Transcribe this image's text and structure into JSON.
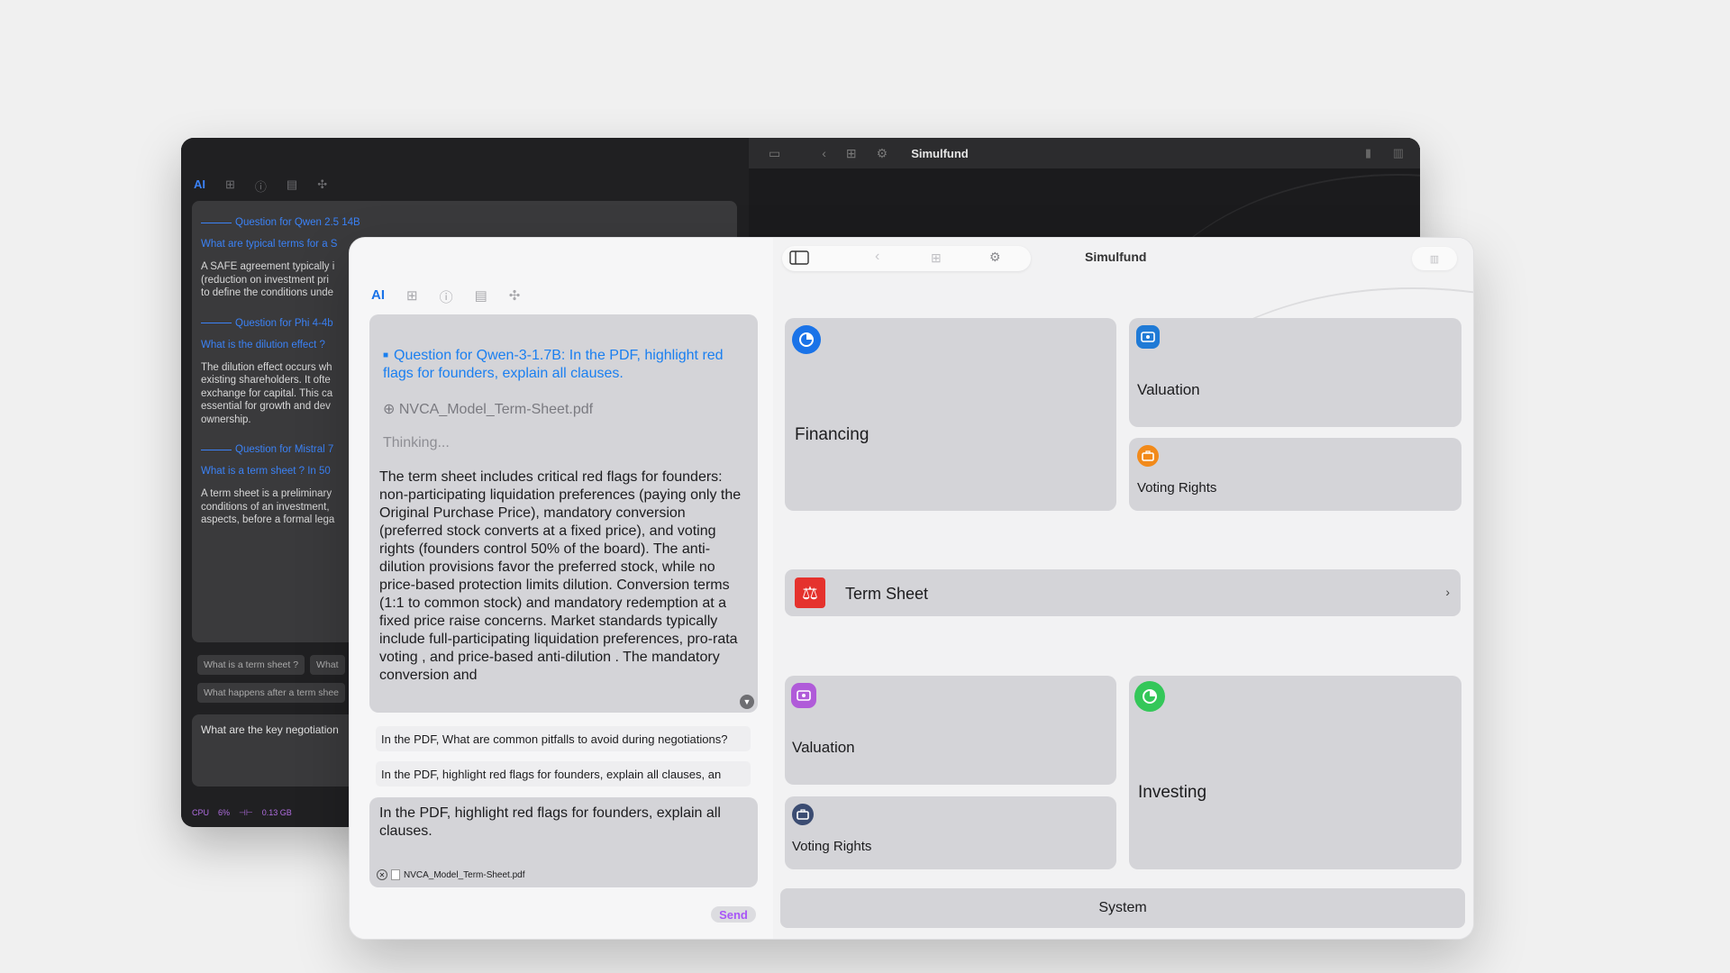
{
  "dark_window": {
    "title": "Simulfund",
    "tabs": [
      "AI",
      "⊞",
      "ⓘ",
      "▤",
      "✣"
    ],
    "chat": [
      {
        "header": "Question for Qwen 2.5 14B",
        "question": "What are typical terms for a S",
        "answer": "A SAFE agreement typically i\n(reduction on investment pri\nto define the conditions unde"
      },
      {
        "header": "Question for Phi 4-4b",
        "question": "What is the dilution effect ?",
        "answer": "The dilution effect occurs wh\nexisting shareholders. It ofte\nexchange for capital. This ca\nessential for growth and dev\nownership."
      },
      {
        "header": "Question for Mistral 7",
        "question": "What is a term sheet ? In 50",
        "answer": "A term sheet is a preliminary\nconditions of an investment,\naspects, before a formal lega"
      }
    ],
    "chips_row1": [
      "What is a term sheet ?",
      "What"
    ],
    "chips_row2": [
      "What happens after a term shee"
    ],
    "input_text": "What are the key negotiation",
    "status": {
      "cpu_label": "CPU",
      "cpu_value": "6%",
      "mem_icon": "⊣⊢",
      "mem_value": "0.13 GB"
    }
  },
  "window": {
    "title": "Simulfund",
    "toolbar_icons": [
      "sidebar-icon",
      "back-icon",
      "grid-icon",
      "gear-icon"
    ],
    "sidebar_toggle_icon": "▥"
  },
  "left_panel": {
    "tabs": [
      {
        "label": "AI",
        "icon": "ai"
      },
      {
        "label": "⊞",
        "icon": "hierarchy-icon"
      },
      {
        "label": "ⓘ",
        "icon": "info-icon"
      },
      {
        "label": "▤",
        "icon": "document-icon"
      },
      {
        "label": "✣",
        "icon": "move-icon"
      }
    ],
    "chat": {
      "question": "Question for Qwen-3-1.7B: In the PDF, highlight red flags for founders, explain all clauses.",
      "file": "NVCA_Model_Term-Sheet.pdf",
      "thinking": "Thinking...",
      "answer": "The term sheet includes critical red flags for founders: non-participating liquidation preferences  (paying only the Original Purchase Price),  mandatory conversion  (preferred stock converts at a fixed price), and  voting rights  (founders control 50% of the board). The  anti-dilution  provisions favor the preferred stock, while  no price-based protection  limits dilution.  Conversion terms  (1:1 to common stock) and  mandatory redemption  at a fixed price raise concerns. Market standards typically include  full-participating liquidation preferences,  pro-rata voting , and  price-based anti-dilution . The  mandatory conversion  and"
    },
    "suggestions": [
      "In the PDF, What are common pitfalls to avoid during negotiations?",
      "In the PDF, highlight red flags for founders, explain all clauses, an"
    ],
    "compose": {
      "text": "In the PDF, highlight red flags for founders, explain all clauses.",
      "attachment": "NVCA_Model_Term-Sheet.pdf"
    },
    "send_label": "Send"
  },
  "tiles": {
    "financing": {
      "label": "Financing",
      "color": "#1a73e8"
    },
    "valuation_top": {
      "label": "Valuation",
      "color": "#1f7ad6"
    },
    "voting_top": {
      "label": "Voting Rights",
      "color": "#f28a1a"
    },
    "term_sheet": {
      "label": "Term Sheet",
      "chevron": "›",
      "color": "#e5322d"
    },
    "valuation_bottom": {
      "label": "Valuation",
      "color": "#b05bd9"
    },
    "voting_bottom": {
      "label": "Voting Rights",
      "color": "#3b4c72"
    },
    "investing": {
      "label": "Investing",
      "color": "#34c759"
    },
    "system": {
      "label": "System"
    }
  }
}
